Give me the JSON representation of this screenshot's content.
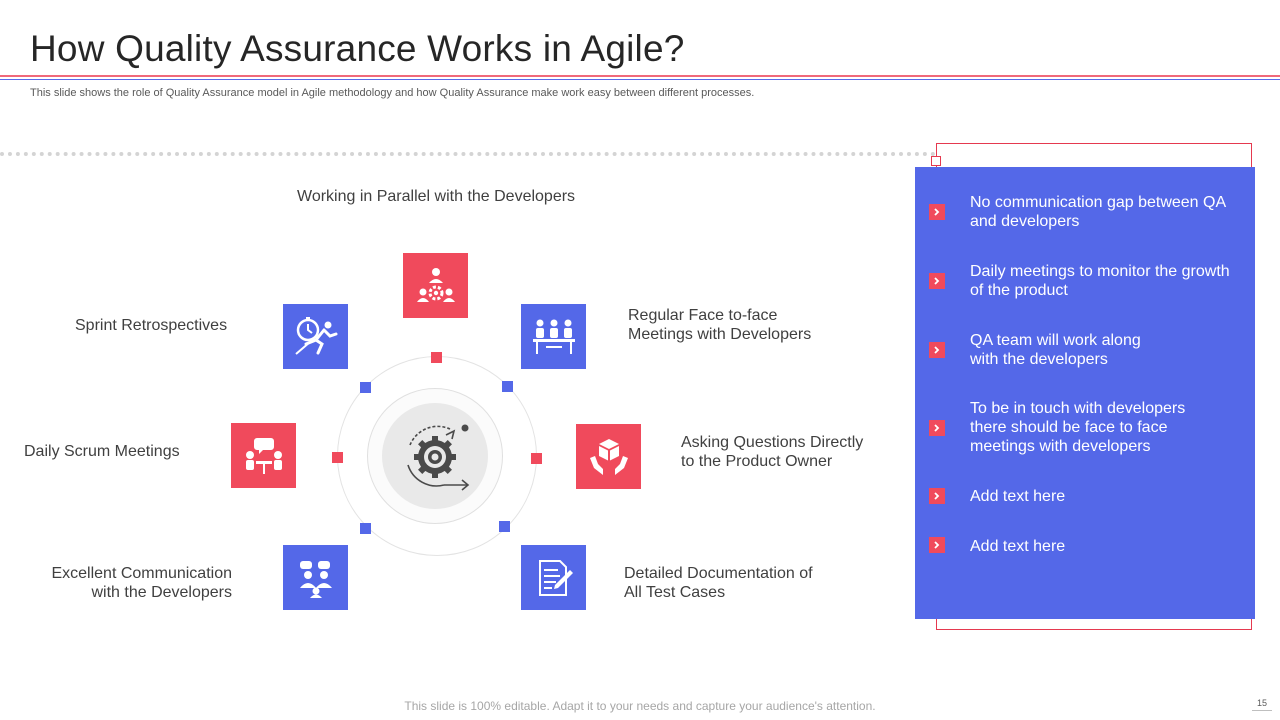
{
  "header": {
    "title": "How Quality Assurance Works in Agile?",
    "subtitle": "This slide shows the role of Quality Assurance model in Agile methodology and how Quality Assurance make work easy between different processes."
  },
  "diagram": {
    "items": [
      {
        "label": "Working in Parallel with the Developers",
        "icon": "team-gear-icon",
        "color": "#f04a5c"
      },
      {
        "label_line1": "Regular Face to-face",
        "label_line2": "Meetings with Developers",
        "icon": "meeting-table-icon",
        "color": "#5468e8"
      },
      {
        "label_line1": "Asking Questions Directly",
        "label_line2": "to the Product Owner",
        "icon": "hands-box-icon",
        "color": "#f04a5c"
      },
      {
        "label_line1": "Detailed Documentation of",
        "label_line2": "All Test Cases",
        "icon": "document-pen-icon",
        "color": "#5468e8"
      },
      {
        "label_line1": "Excellent Communication",
        "label_line2": "with the Developers",
        "icon": "people-chat-icon",
        "color": "#5468e8"
      },
      {
        "label": "Daily Scrum Meetings",
        "icon": "discussion-icon",
        "color": "#f04a5c"
      },
      {
        "label": "Sprint Retrospectives",
        "icon": "stopwatch-runner-icon",
        "color": "#5468e8"
      }
    ],
    "center_icon": "agile-gear-cycle-icon"
  },
  "panel": {
    "bullets": [
      {
        "line1": "No communication gap  between QA",
        "line2": "and developers"
      },
      {
        "line1": "Daily meetings to monitor the growth",
        "line2": "of the product"
      },
      {
        "line1": "QA team will work along",
        "line2": "with the developers"
      },
      {
        "line1": "To be in touch with developers",
        "line2": "there should be face to face",
        "line3": "meetings with developers"
      },
      {
        "line1": "Add text here"
      },
      {
        "line1": "Add text here"
      }
    ],
    "bullet_icon": "chevron-right-icon"
  },
  "footer": {
    "note": "This slide is 100% editable. Adapt it to your needs and capture your audience's attention.",
    "page_number": "15"
  },
  "colors": {
    "accent_red": "#f04a5c",
    "accent_blue": "#5468e8"
  }
}
